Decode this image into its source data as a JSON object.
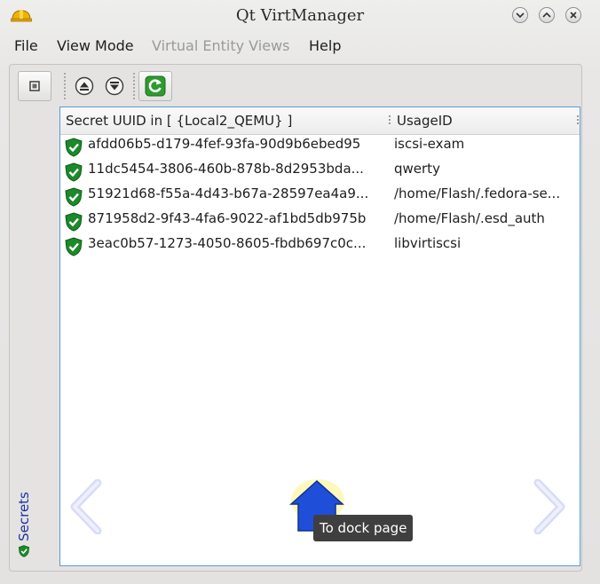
{
  "window": {
    "title": "Qt VirtManager",
    "icon": "hardhat-icon"
  },
  "menubar": {
    "items": [
      {
        "label": "File",
        "enabled": true
      },
      {
        "label": "View Mode",
        "enabled": true
      },
      {
        "label": "Virtual Entity Views",
        "enabled": false
      },
      {
        "label": "Help",
        "enabled": true
      }
    ]
  },
  "toolbar": {
    "buttons": [
      "stop-icon",
      "eject-up-icon",
      "eject-down-icon",
      "refresh-icon"
    ]
  },
  "sidetab": {
    "label": "Secrets"
  },
  "table": {
    "columns": [
      "Secret UUID in [ {Local2_QEMU} ]",
      "UsageID"
    ],
    "rows": [
      {
        "uuid": "afdd06b5-d179-4fef-93fa-90d9b6ebed95",
        "usage": "iscsi-exam"
      },
      {
        "uuid": "11dc5454-3806-460b-878b-8d2953bda...",
        "usage": "qwerty"
      },
      {
        "uuid": "51921d68-f55a-4d43-b67a-28597ea4a9...",
        "usage": "/home/Flash/.fedora-se..."
      },
      {
        "uuid": "871958d2-9f43-4fa6-9022-af1bd5db975b",
        "usage": "/home/Flash/.esd_auth"
      },
      {
        "uuid": "3eac0b57-1273-4050-8605-fbdb697c0c...",
        "usage": "libvirtiscsi"
      }
    ]
  },
  "dock_nav": {
    "tooltip": "To dock page"
  },
  "colors": {
    "accent": "#1f4fd8",
    "shield": "#1b8a2a",
    "focus_border": "#5a9bd8"
  }
}
